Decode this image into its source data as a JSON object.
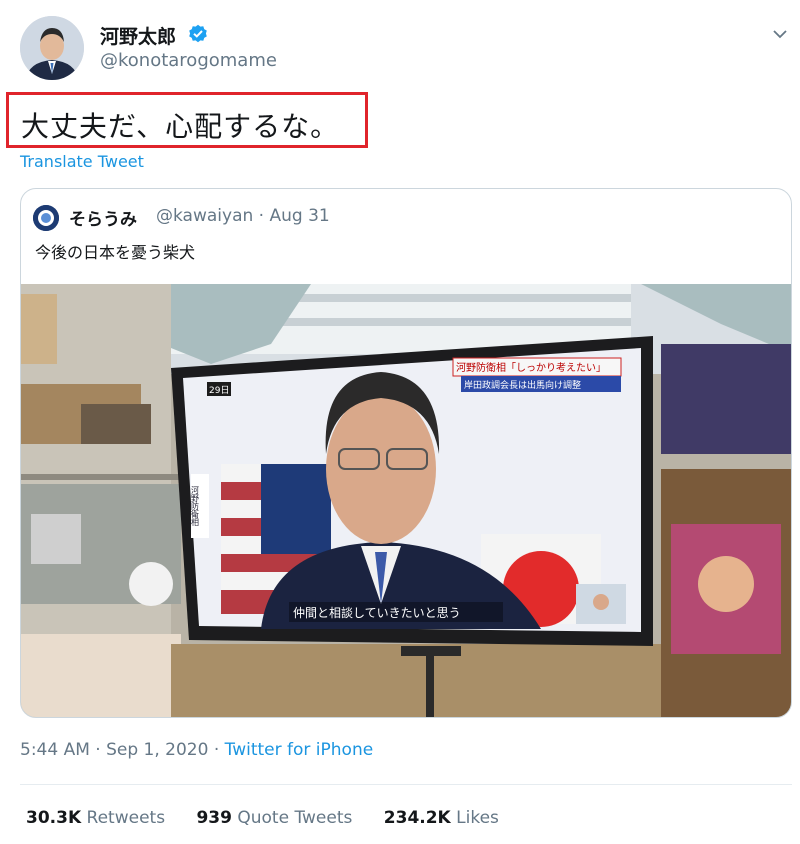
{
  "author": {
    "display_name": "河野太郎",
    "handle": "@konotarogomame",
    "verified": true
  },
  "tweet": {
    "text": "大丈夫だ、心配するな。",
    "translate_label": "Translate Tweet"
  },
  "quoted_tweet": {
    "display_name": "そらうみ",
    "handle_and_date": "@kawaiyan · Aug 31",
    "text": "今後の日本を憂う柴犬",
    "media": {
      "tv_date_badge": "29日",
      "tv_headline_top": "河野防衛相「しっかり考えたい」",
      "tv_headline_bottom": "岸田政調会長は出馬向け調整",
      "tv_side_caption": "河野防衛相",
      "tv_subtitle": "仲間と相談していきたいと思う"
    }
  },
  "meta": {
    "timestamp": "5:44 AM · Sep 1, 2020 · ",
    "source": "Twitter for iPhone"
  },
  "stats": {
    "retweets_count": "30.3K",
    "retweets_label": "Retweets",
    "quote_count": "939",
    "quote_label": "Quote Tweets",
    "likes_count": "234.2K",
    "likes_label": "Likes"
  },
  "colors": {
    "link": "#1b95e0",
    "highlight_box": "#e0242b",
    "secondary_text": "#657786"
  },
  "icons": [
    "verified-badge-icon",
    "chevron-down-icon"
  ]
}
